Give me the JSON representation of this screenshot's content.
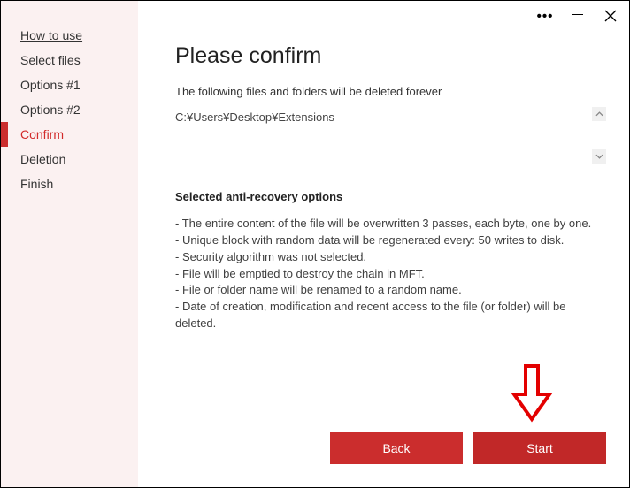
{
  "sidebar": {
    "items": [
      {
        "label": "How to use"
      },
      {
        "label": "Select files"
      },
      {
        "label": "Options #1"
      },
      {
        "label": "Options #2"
      },
      {
        "label": "Confirm"
      },
      {
        "label": "Deletion"
      },
      {
        "label": "Finish"
      }
    ]
  },
  "titlebar": {
    "more_label": "•••"
  },
  "main": {
    "title": "Please confirm",
    "subheading": "The following files and folders will be deleted forever",
    "files": [
      "C:¥Users¥Desktop¥Extensions"
    ],
    "options_heading": "Selected anti-recovery options",
    "options": [
      "- The entire content of the file will be overwritten 3 passes, each byte, one by one.",
      "- Unique block with random data will be regenerated every: 50 writes to disk.",
      "- Security algorithm was not selected.",
      "- File will be emptied to destroy the chain in MFT.",
      "- File or folder name will be renamed to a random name.",
      "- Date of creation, modification and recent access to the file (or folder) will be deleted."
    ]
  },
  "buttons": {
    "back": "Back",
    "start": "Start"
  },
  "colors": {
    "accent": "#cb2d2d"
  }
}
